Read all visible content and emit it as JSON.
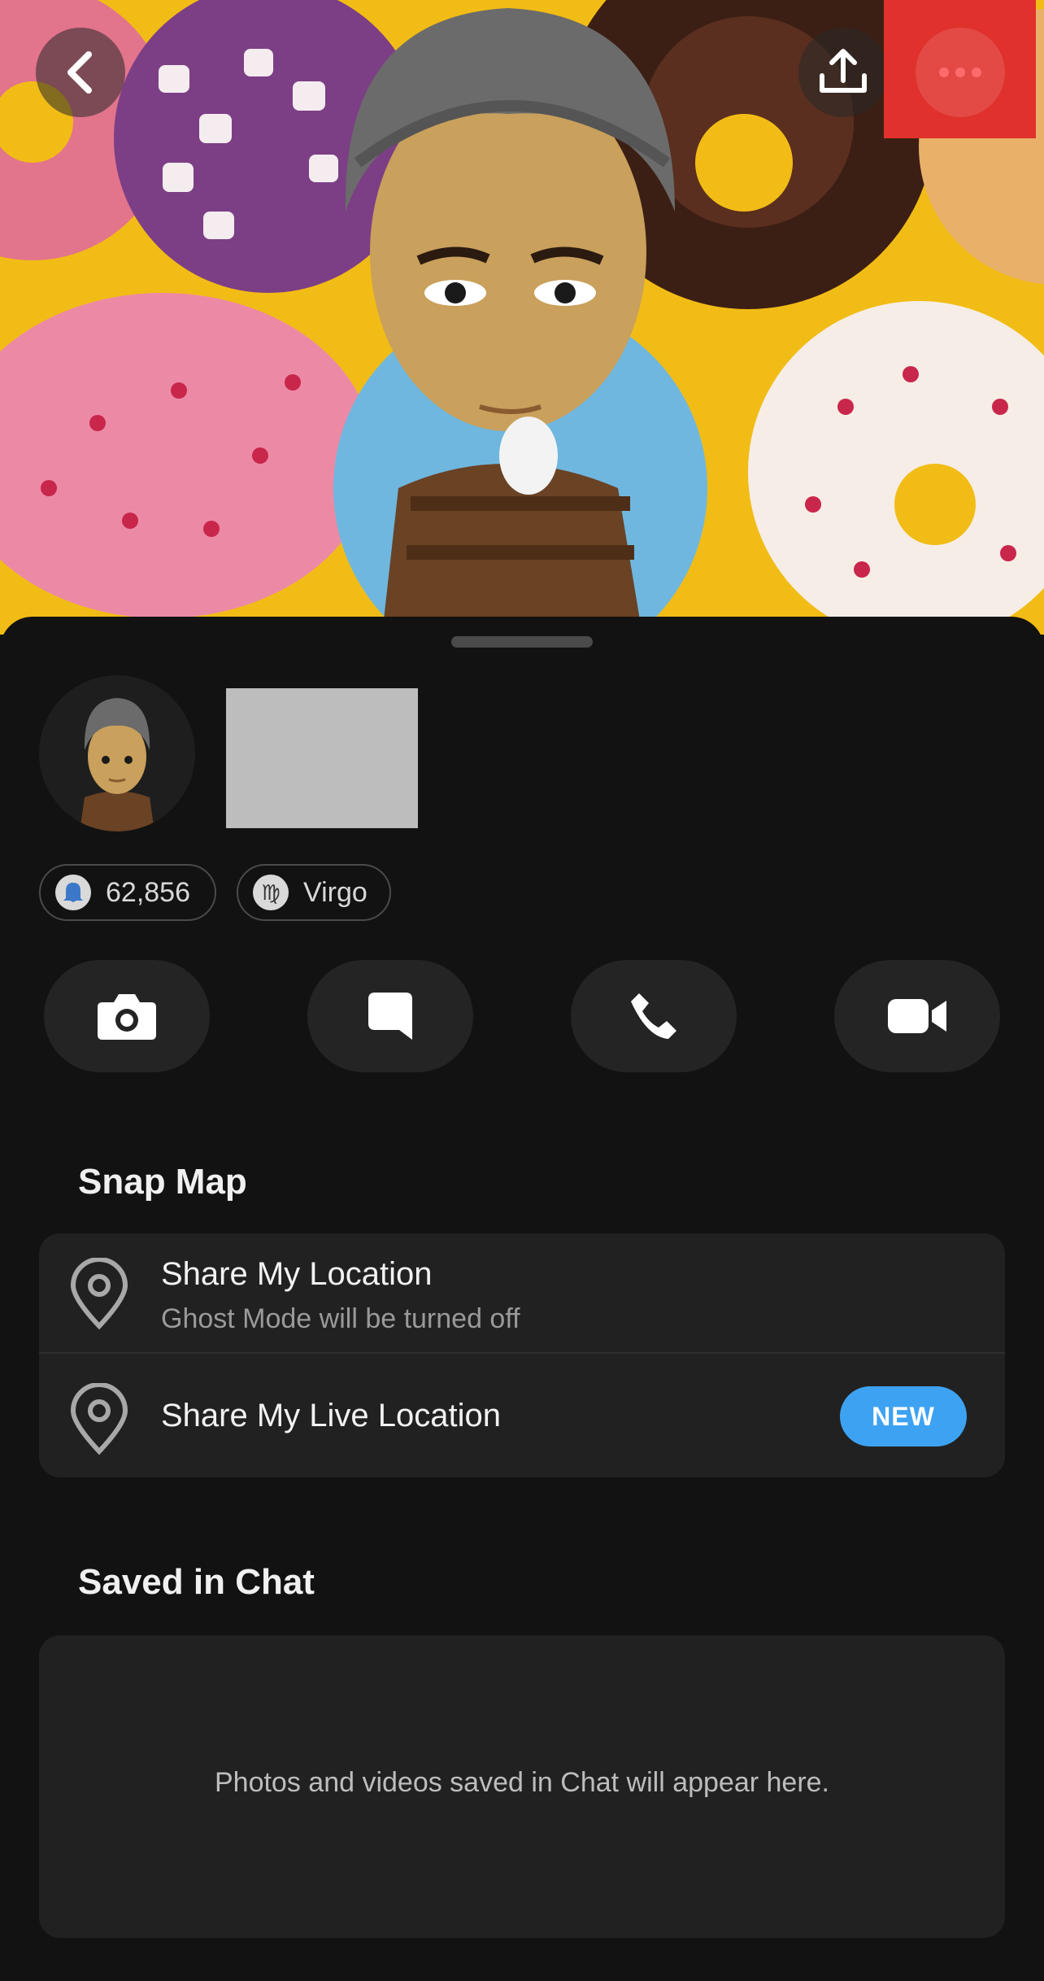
{
  "header": {
    "back_icon": "chevron-left-icon",
    "share_icon": "upload-icon",
    "more_icon": "more-horizontal-icon"
  },
  "profile": {
    "snap_score": "62,856",
    "zodiac": "Virgo"
  },
  "actions": [
    {
      "icon": "camera-icon"
    },
    {
      "icon": "chat-icon"
    },
    {
      "icon": "phone-icon"
    },
    {
      "icon": "video-icon"
    }
  ],
  "snap_map": {
    "title": "Snap Map",
    "items": [
      {
        "title": "Share My Location",
        "subtitle": "Ghost Mode will be turned off"
      },
      {
        "title": "Share My Live Location",
        "badge": "NEW"
      }
    ]
  },
  "saved_in_chat": {
    "title": "Saved in Chat",
    "empty_text": "Photos and videos saved in Chat will appear here."
  },
  "colors": {
    "background": "#121212",
    "card": "#212121",
    "accent_blue": "#3ea2f2",
    "highlight_red": "#e0312c"
  }
}
